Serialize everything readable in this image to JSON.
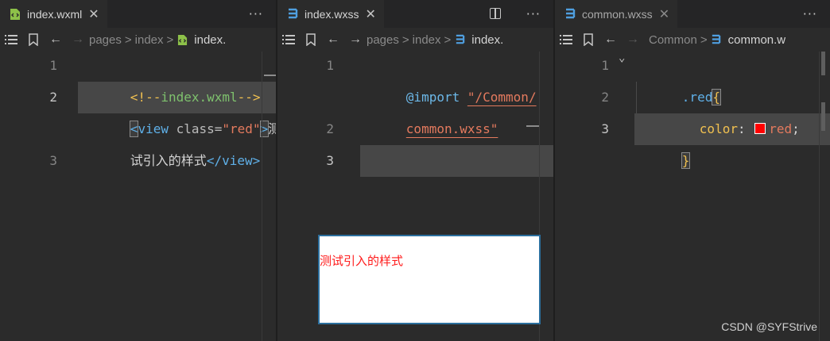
{
  "colors": {
    "editor_bg": "#2b2b2b",
    "line_highlight": "#474747",
    "tag": "#5fb0e8",
    "string": "#e47a5e",
    "comment": "#f0c050",
    "preview_text": "#ff1b1b",
    "swatch_red": "#ff0000"
  },
  "icons": {
    "wxml_file": "wxml-file-icon",
    "css_file": "css-file-icon",
    "outline": "list-icon",
    "bookmark": "bookmark-icon",
    "back": "arrow-left-icon",
    "forward": "arrow-right-icon",
    "split": "split-editor-icon",
    "more": "more-icon",
    "close": "close-icon",
    "fold": "chevron-down-icon"
  },
  "pane1": {
    "tab": {
      "label": "index.wxml",
      "close": "✕"
    },
    "more": "···",
    "breadcrumb": [
      "pages",
      "index",
      "index."
    ],
    "lines": [
      {
        "num": "1",
        "comment_open": "<!--",
        "comment_body": "index.wxml",
        "comment_close": "-->"
      },
      {
        "num": "2",
        "lt": "<",
        "tag": "view",
        "attr": " class=",
        "val": "\"red\"",
        "gt": ">",
        "text1": "测"
      },
      {
        "text2": "试引入的样式",
        "close_tag": "</view>"
      },
      {
        "num": "3"
      }
    ]
  },
  "pane2": {
    "tab": {
      "label": "index.wxss",
      "close": "✕"
    },
    "more": "···",
    "breadcrumb": [
      "pages",
      "index",
      "index."
    ],
    "lines": [
      {
        "num": "1",
        "kw": "@import",
        "str_a": "\"/Common/",
        "str_b": "common.wxss\""
      },
      {
        "num": "2"
      },
      {
        "num": "3"
      }
    ],
    "preview_text": "测试引入的样式"
  },
  "pane3": {
    "tab": {
      "label": "common.wxss",
      "close": "✕"
    },
    "more": "···",
    "breadcrumb": [
      "Common",
      "common.w"
    ],
    "lines": [
      {
        "num": "1",
        "sel": ".red",
        "brace": "{"
      },
      {
        "num": "2",
        "prop": "color",
        "colon": ": ",
        "val": "red",
        "semi": ";"
      },
      {
        "num": "3",
        "brace": "}"
      }
    ]
  },
  "watermark": "CSDN @SYFStrive"
}
